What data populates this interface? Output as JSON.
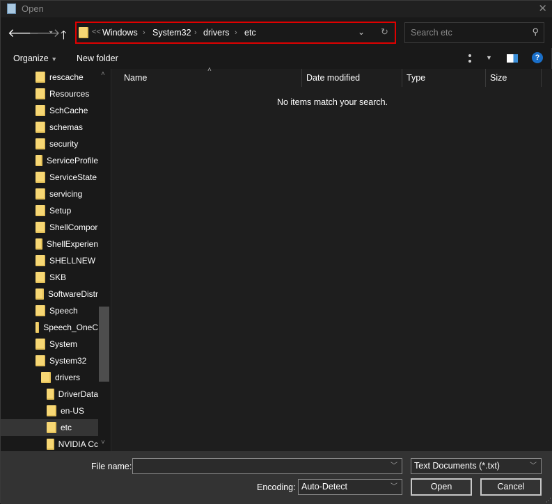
{
  "window": {
    "title": "Open"
  },
  "address": {
    "crumbs": [
      "Windows",
      "System32",
      "drivers",
      "etc"
    ],
    "overflow": "<<"
  },
  "search": {
    "placeholder": "Search etc"
  },
  "toolbar": {
    "organize": "Organize",
    "new_folder": "New folder"
  },
  "tree": [
    {
      "label": "rescache",
      "level": 1
    },
    {
      "label": "Resources",
      "level": 1
    },
    {
      "label": "SchCache",
      "level": 1
    },
    {
      "label": "schemas",
      "level": 1
    },
    {
      "label": "security",
      "level": 1
    },
    {
      "label": "ServiceProfile",
      "level": 1
    },
    {
      "label": "ServiceState",
      "level": 1
    },
    {
      "label": "servicing",
      "level": 1
    },
    {
      "label": "Setup",
      "level": 1
    },
    {
      "label": "ShellCompor",
      "level": 1
    },
    {
      "label": "ShellExperien",
      "level": 1
    },
    {
      "label": "SHELLNEW",
      "level": 1
    },
    {
      "label": "SKB",
      "level": 1
    },
    {
      "label": "SoftwareDistr",
      "level": 1
    },
    {
      "label": "Speech",
      "level": 1
    },
    {
      "label": "Speech_OneC",
      "level": 1
    },
    {
      "label": "System",
      "level": 1
    },
    {
      "label": "System32",
      "level": 1
    },
    {
      "label": "drivers",
      "level": 2
    },
    {
      "label": "DriverData",
      "level": 3
    },
    {
      "label": "en-US",
      "level": 3
    },
    {
      "label": "etc",
      "level": 3,
      "selected": true
    },
    {
      "label": "NVIDIA Cc",
      "level": 3
    }
  ],
  "columns": [
    "Name",
    "Date modified",
    "Type",
    "Size"
  ],
  "empty_message": "No items match your search.",
  "footer": {
    "file_name_label": "File name:",
    "file_name_value": "",
    "file_type": "Text Documents (*.txt)",
    "encoding_label": "Encoding:",
    "encoding_value": "Auto-Detect",
    "open": "Open",
    "cancel": "Cancel"
  },
  "colors": {
    "highlight": "#e00000",
    "folder": "#f7d774"
  }
}
